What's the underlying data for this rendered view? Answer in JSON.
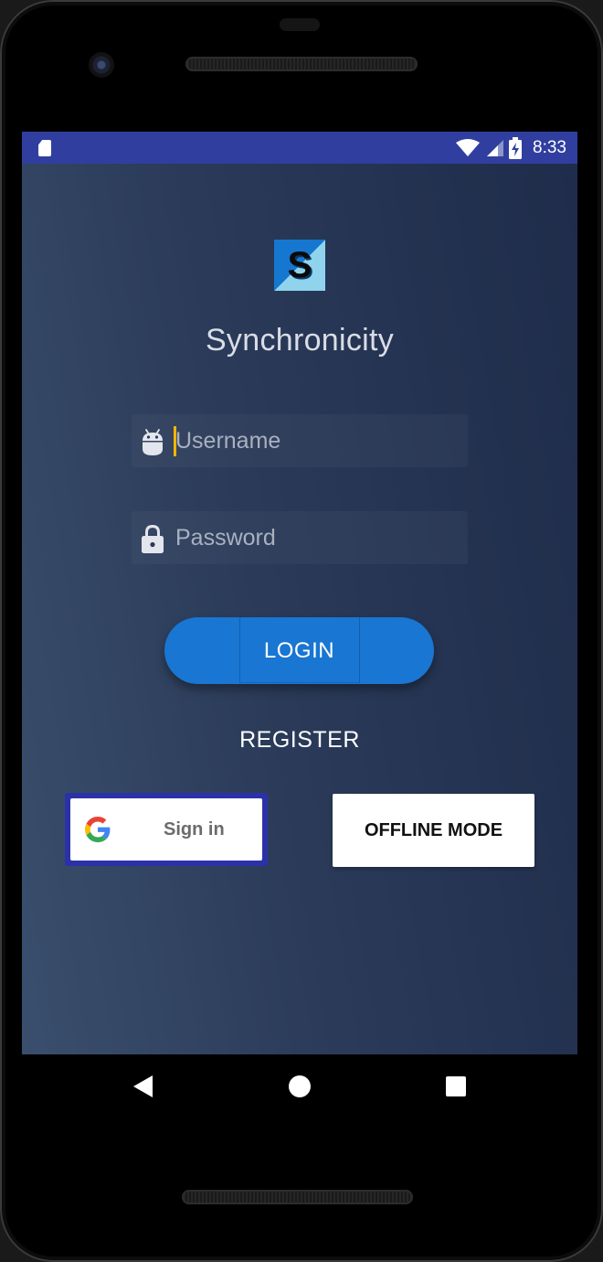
{
  "status_bar": {
    "time": "8:33",
    "background_color": "#303f9f",
    "icons": [
      "sd-card-icon",
      "wifi-icon",
      "cellular-signal-icon",
      "battery-charging-icon"
    ]
  },
  "app": {
    "logo_letter": "S",
    "title": "Synchronicity"
  },
  "form": {
    "username_placeholder": "Username",
    "username_value": "",
    "username_icon": "android-icon",
    "password_placeholder": "Password",
    "password_value": "",
    "password_icon": "lock-icon"
  },
  "actions": {
    "login_label": "LOGIN",
    "register_label": "REGISTER",
    "google_signin_label": "Sign in",
    "offline_label": "OFFLINE MODE"
  },
  "navigation": {
    "icons": [
      "back-icon",
      "home-icon",
      "recents-icon"
    ]
  },
  "colors": {
    "accent": "#1976d2",
    "google_border": "#2b32a8",
    "cursor": "#f5b400"
  }
}
